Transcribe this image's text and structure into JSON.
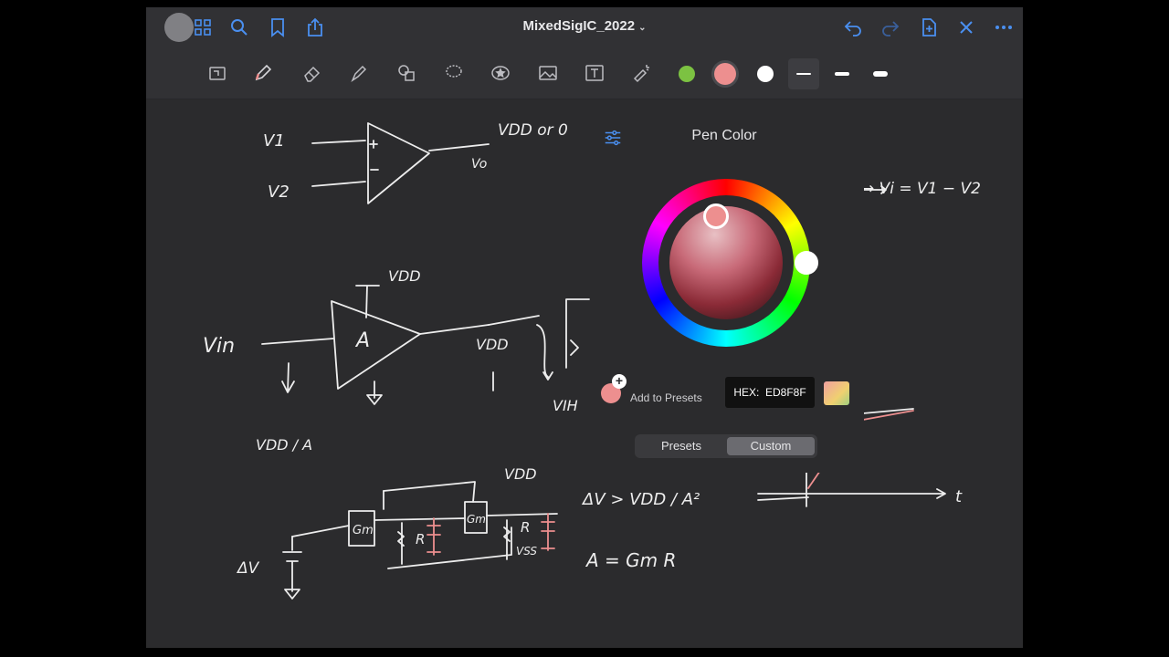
{
  "app": {
    "title": "MixedSigIC_2022"
  },
  "top_icons": [
    "back-icon",
    "grid-icon",
    "search-icon",
    "bookmark-icon",
    "share-icon",
    "undo-icon",
    "redo-icon",
    "add-page-icon",
    "close-icon",
    "more-icon"
  ],
  "toolbar": {
    "tools": [
      "crop-icon",
      "pen-icon",
      "eraser-icon",
      "highlighter-icon",
      "shapes-icon",
      "lasso-icon",
      "sticker-icon",
      "image-icon",
      "text-icon",
      "laser-icon"
    ],
    "colors": [
      "#7cc242",
      "#ed8f8f",
      "#ffffff"
    ],
    "selected_color": "#ed8f8f",
    "accent": "#3b82f6"
  },
  "pen_color": {
    "title": "Pen Color",
    "add_to_presets": "Add to Presets",
    "hex_label": "HEX:",
    "hex_value": "ED8F8F",
    "tabs": [
      "Presets",
      "Custom"
    ],
    "selected_tab": "Custom"
  },
  "notes": {
    "v1": "V1",
    "v2": "V2",
    "vdd_or_0": "VDD or 0",
    "vo": "Vo",
    "vi_eq": "→ Vi = V1 − V2",
    "vin": "Vin",
    "vdd": "VDD",
    "a": "A",
    "vih": "VIH",
    "vdd_over_a": "VDD / A",
    "dv": "ΔV",
    "gm": "Gm",
    "r": "R",
    "vss": "VSS",
    "dv_cond": "ΔV > VDD / A²",
    "a_eq": "A = Gm R",
    "t": "t"
  }
}
